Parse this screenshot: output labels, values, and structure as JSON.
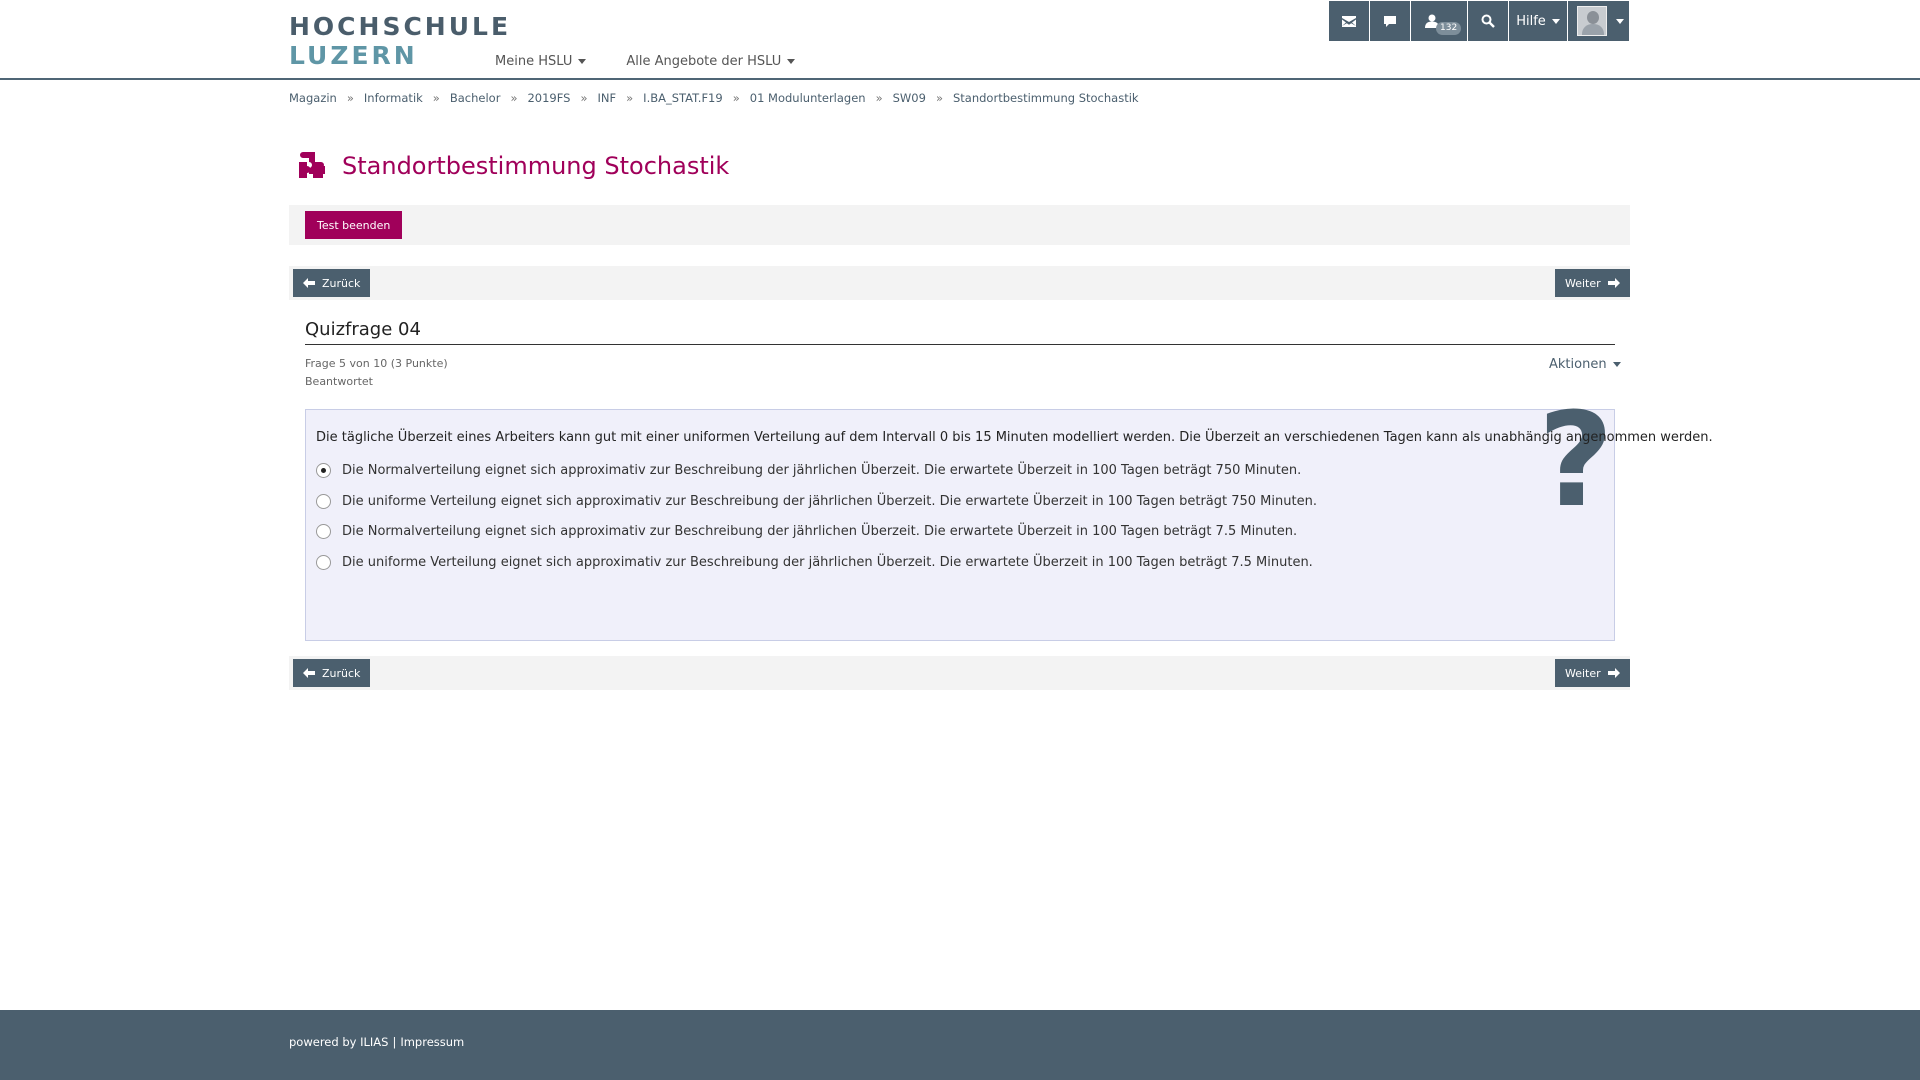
{
  "logo": {
    "line1": "HOCHSCHULE",
    "line2": "LUZERN"
  },
  "nav": {
    "items": [
      {
        "label": "Meine HSLU"
      },
      {
        "label": "Alle Angebote der HSLU"
      }
    ]
  },
  "topbar": {
    "mail_icon": "mail-icon",
    "chat_icon": "chat-icon",
    "user_icon": "user-icon",
    "user_count": "132",
    "search_icon": "search-icon",
    "help_label": "Hilfe",
    "avatar_icon": "avatar"
  },
  "breadcrumb": {
    "separator": "»",
    "items": [
      "Magazin",
      "Informatik",
      "Bachelor",
      "2019FS",
      "INF",
      "I.BA_STAT.F19",
      "01 Modulunterlagen",
      "SW09",
      "Standortbestimmung Stochastik"
    ]
  },
  "page": {
    "title": "Standortbestimmung Stochastik",
    "title_icon": "puzzle-icon"
  },
  "test": {
    "end_button": "Test beenden",
    "prev_label": "Zurück",
    "next_label": "Weiter"
  },
  "question": {
    "title": "Quizfrage 04",
    "progress": "Frage 5 von 10 (3 Punkte)",
    "status": "Beantwortet",
    "actions_label": "Aktionen",
    "text": "Die tägliche Überzeit eines Arbeiters kann gut mit einer uniformen Verteilung auf dem Intervall 0 bis 15 Minuten modelliert werden. Die Überzeit an verschiedenen Tagen kann als unabhängig angenommen werden.",
    "mark": "?",
    "selected_index": 0,
    "options": [
      "Die Normalverteilung eignet sich approximativ zur Beschreibung der jährlichen Überzeit. Die erwartete Überzeit in 100 Tagen beträgt 750 Minuten.",
      "Die uniforme Verteilung eignet sich approximativ zur Beschreibung der jährlichen Überzeit. Die erwartete Überzeit in 100 Tagen beträgt 750 Minuten.",
      "Die Normalverteilung eignet sich approximativ zur Beschreibung der jährlichen Überzeit. Die erwartete Überzeit in 100 Tagen beträgt 7.5 Minuten.",
      "Die uniforme Verteilung eignet sich approximativ zur Beschreibung der jährlichen Überzeit. Die erwartete Überzeit in 100 Tagen beträgt 7.5 Minuten."
    ]
  },
  "footer": {
    "powered": "powered by ILIAS",
    "divider": "|",
    "impressum": "Impressum"
  },
  "colors": {
    "accent": "#a0005a",
    "dark": "#4b5f6e",
    "question_bg": "#f0f0fa"
  }
}
